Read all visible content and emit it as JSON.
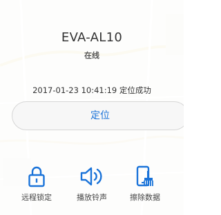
{
  "device": {
    "name": "EVA-AL10",
    "status": "在线",
    "locate_time": "2017-01-23 10:41:19 定位成功"
  },
  "locate_button": {
    "label": "定位"
  },
  "actions": [
    {
      "label": "远程锁定",
      "icon": "lock-icon"
    },
    {
      "label": "播放铃声",
      "icon": "speaker-icon"
    },
    {
      "label": "擦除数据",
      "icon": "phone-erase-icon"
    }
  ],
  "colors": {
    "accent": "#1a73d9",
    "text": "#333333",
    "button_bg": "#f7f7f7"
  }
}
